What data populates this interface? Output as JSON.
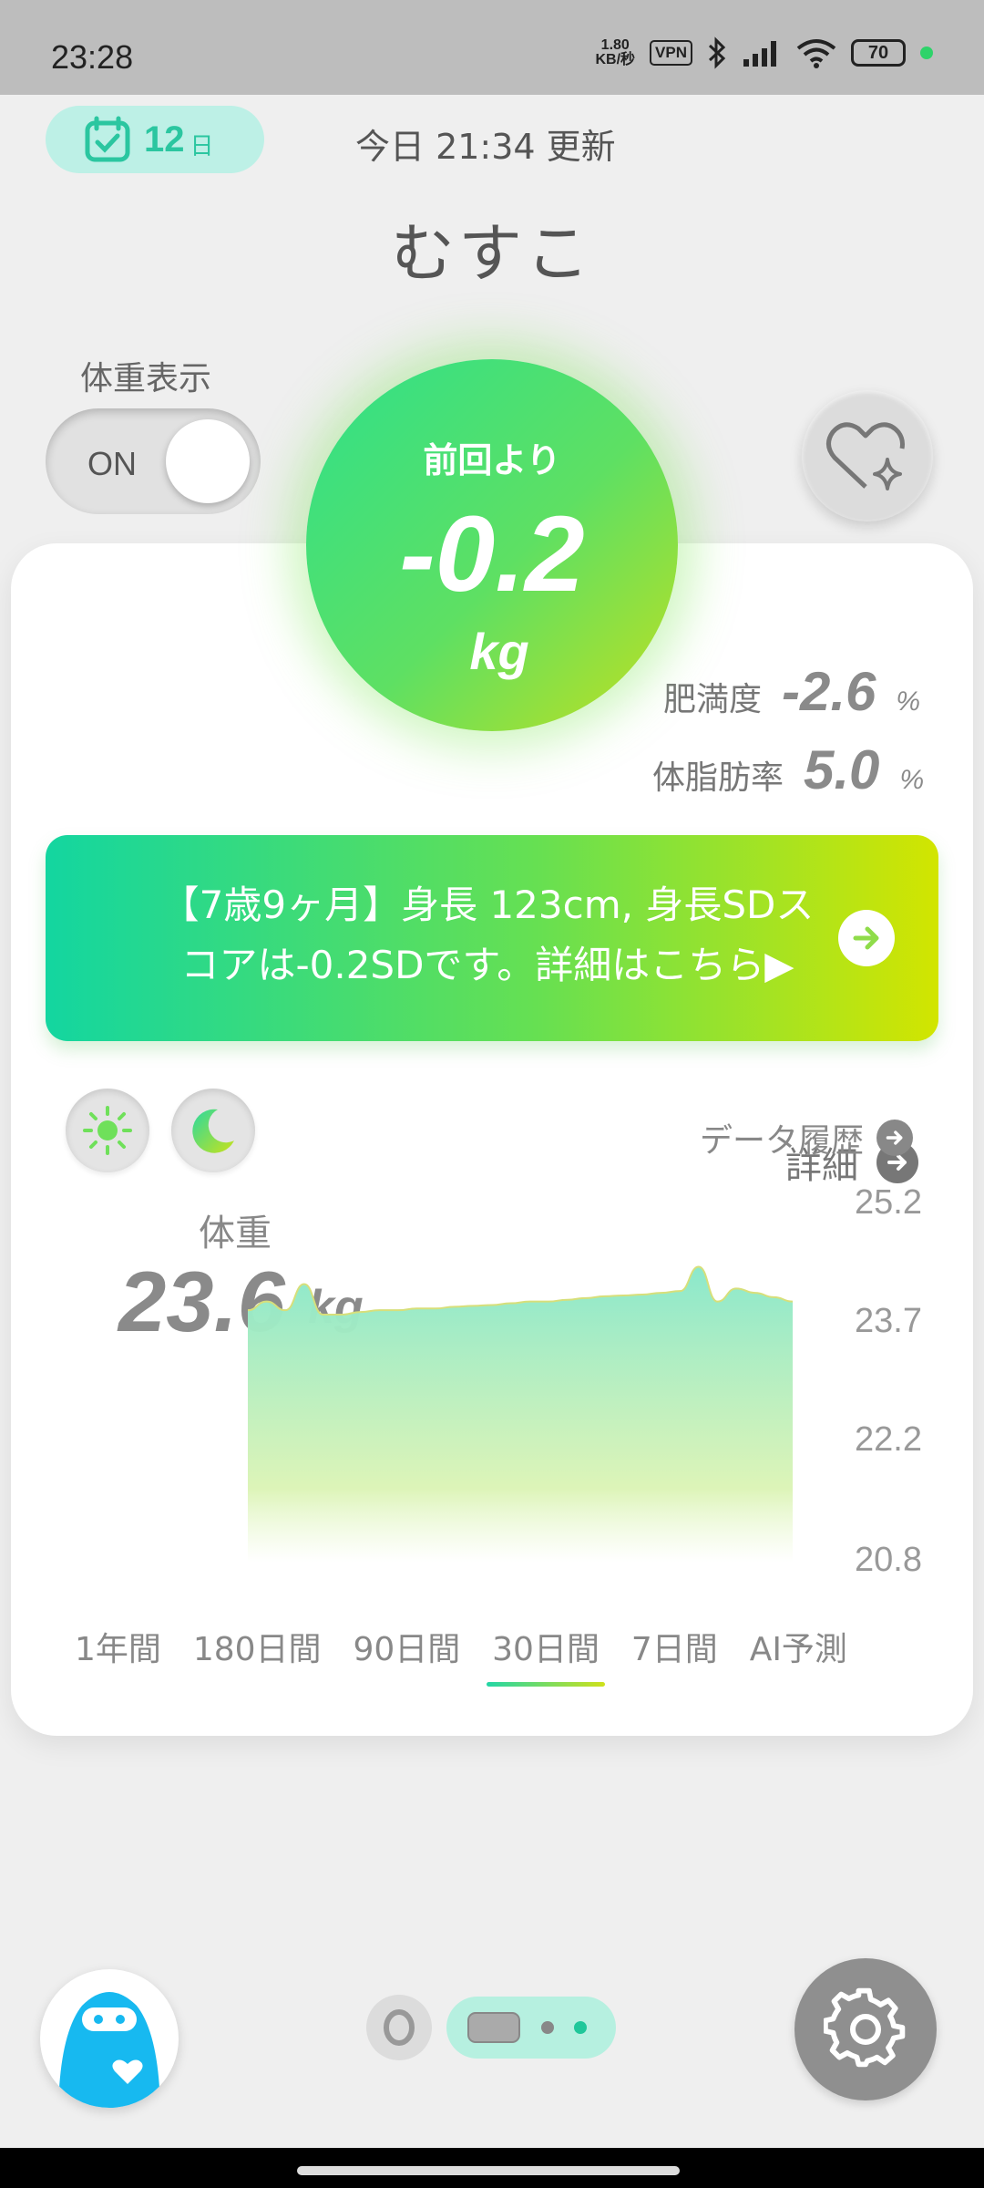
{
  "status_bar": {
    "time": "23:28",
    "net_speed": "1.80",
    "net_unit": "KB/秒",
    "vpn": "VPN",
    "battery": "70",
    "indicator_color": "#2ed36a"
  },
  "header": {
    "streak_days": "12",
    "streak_unit": "日",
    "updated_text": "今日 21:34 更新",
    "user_name": "むすこ"
  },
  "weight_toggle": {
    "label": "体重表示",
    "state": "ON"
  },
  "diff_bubble": {
    "label": "前回より",
    "value": "-0.2",
    "unit": "kg"
  },
  "body_weight": {
    "label": "体重",
    "value": "23.6",
    "unit": "kg"
  },
  "details_link": "詳細",
  "metrics": [
    {
      "label": "肥満度",
      "value": "-2.6",
      "unit": "%"
    },
    {
      "label": "体脂肪率",
      "value": "5.0",
      "unit": "%"
    }
  ],
  "banner": {
    "line1": "【7歳9ヶ月】身長 123cm, 身長SDス",
    "line2": "コアは-0.2SDです。詳細はこちら▶"
  },
  "chart_controls": {
    "day_icon": "sun-icon",
    "night_icon": "moon-icon",
    "history_link": "データ履歴"
  },
  "chart_data": {
    "type": "area",
    "y_ticks": [
      "25.2",
      "23.7",
      "22.2",
      "20.8"
    ],
    "ylim": [
      20.8,
      25.2
    ],
    "x": [
      1,
      2,
      3,
      4,
      5,
      6,
      7,
      8,
      9,
      10,
      11,
      12,
      13,
      14,
      15,
      16,
      17,
      18,
      19,
      20,
      21,
      22,
      23,
      24,
      25,
      26,
      27,
      28,
      29,
      30
    ],
    "values": [
      23.7,
      23.8,
      23.7,
      24.0,
      23.65,
      23.65,
      23.68,
      23.7,
      23.7,
      23.72,
      23.72,
      23.74,
      23.75,
      23.76,
      23.78,
      23.8,
      23.8,
      23.82,
      23.84,
      23.86,
      23.87,
      23.88,
      23.9,
      23.92,
      24.2,
      23.8,
      23.95,
      23.9,
      23.85,
      23.8
    ],
    "grid": false,
    "fill_colors": [
      "#8be8cc",
      "#d9f3b0"
    ]
  },
  "ranges": {
    "items": [
      "1年間",
      "180日間",
      "90日間",
      "30日間",
      "7日間",
      "AI予測"
    ],
    "active_index": 3
  },
  "bottom_bar": {
    "mascot_icon": "mascot-avatar-icon",
    "settings_icon": "gear-icon"
  },
  "colors": {
    "accent_green": "#2bc6a0",
    "gradient_start": "#13d6a0",
    "gradient_end": "#d2e500"
  }
}
